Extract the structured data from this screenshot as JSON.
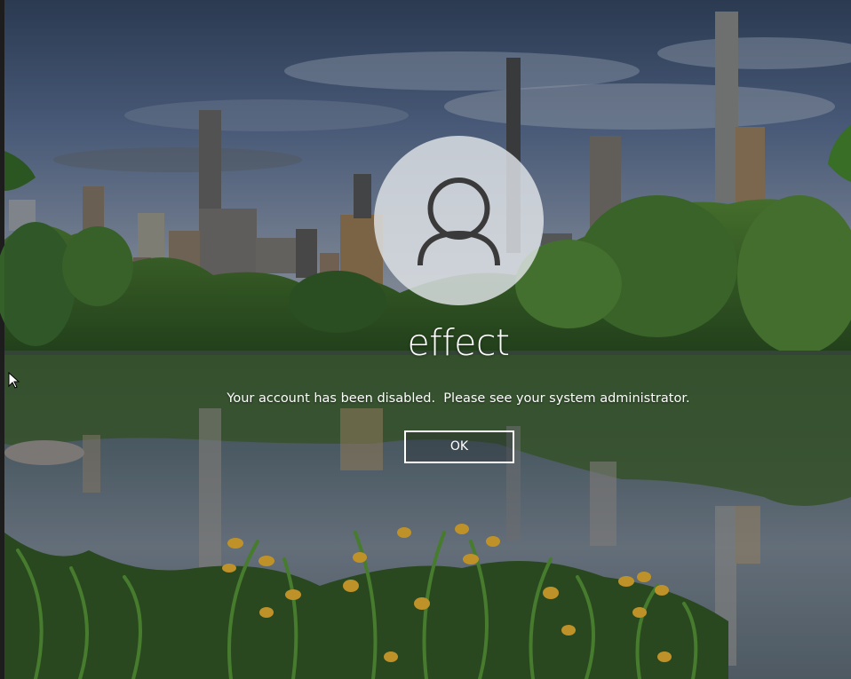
{
  "account": {
    "username": "effect",
    "avatar_icon": "user-silhouette-icon"
  },
  "dialog": {
    "message": "Your account has been disabled.  Please see your system administrator.",
    "ok_label": "OK"
  },
  "background": {
    "description_icon": "city-park-lake-wallpaper",
    "sky_top": "#3a4d68",
    "sky_bottom": "#8a96a8",
    "foliage": "#2f5a22",
    "water": "#4b5a63"
  },
  "pointer": {
    "icon": "mouse-pointer-icon"
  }
}
